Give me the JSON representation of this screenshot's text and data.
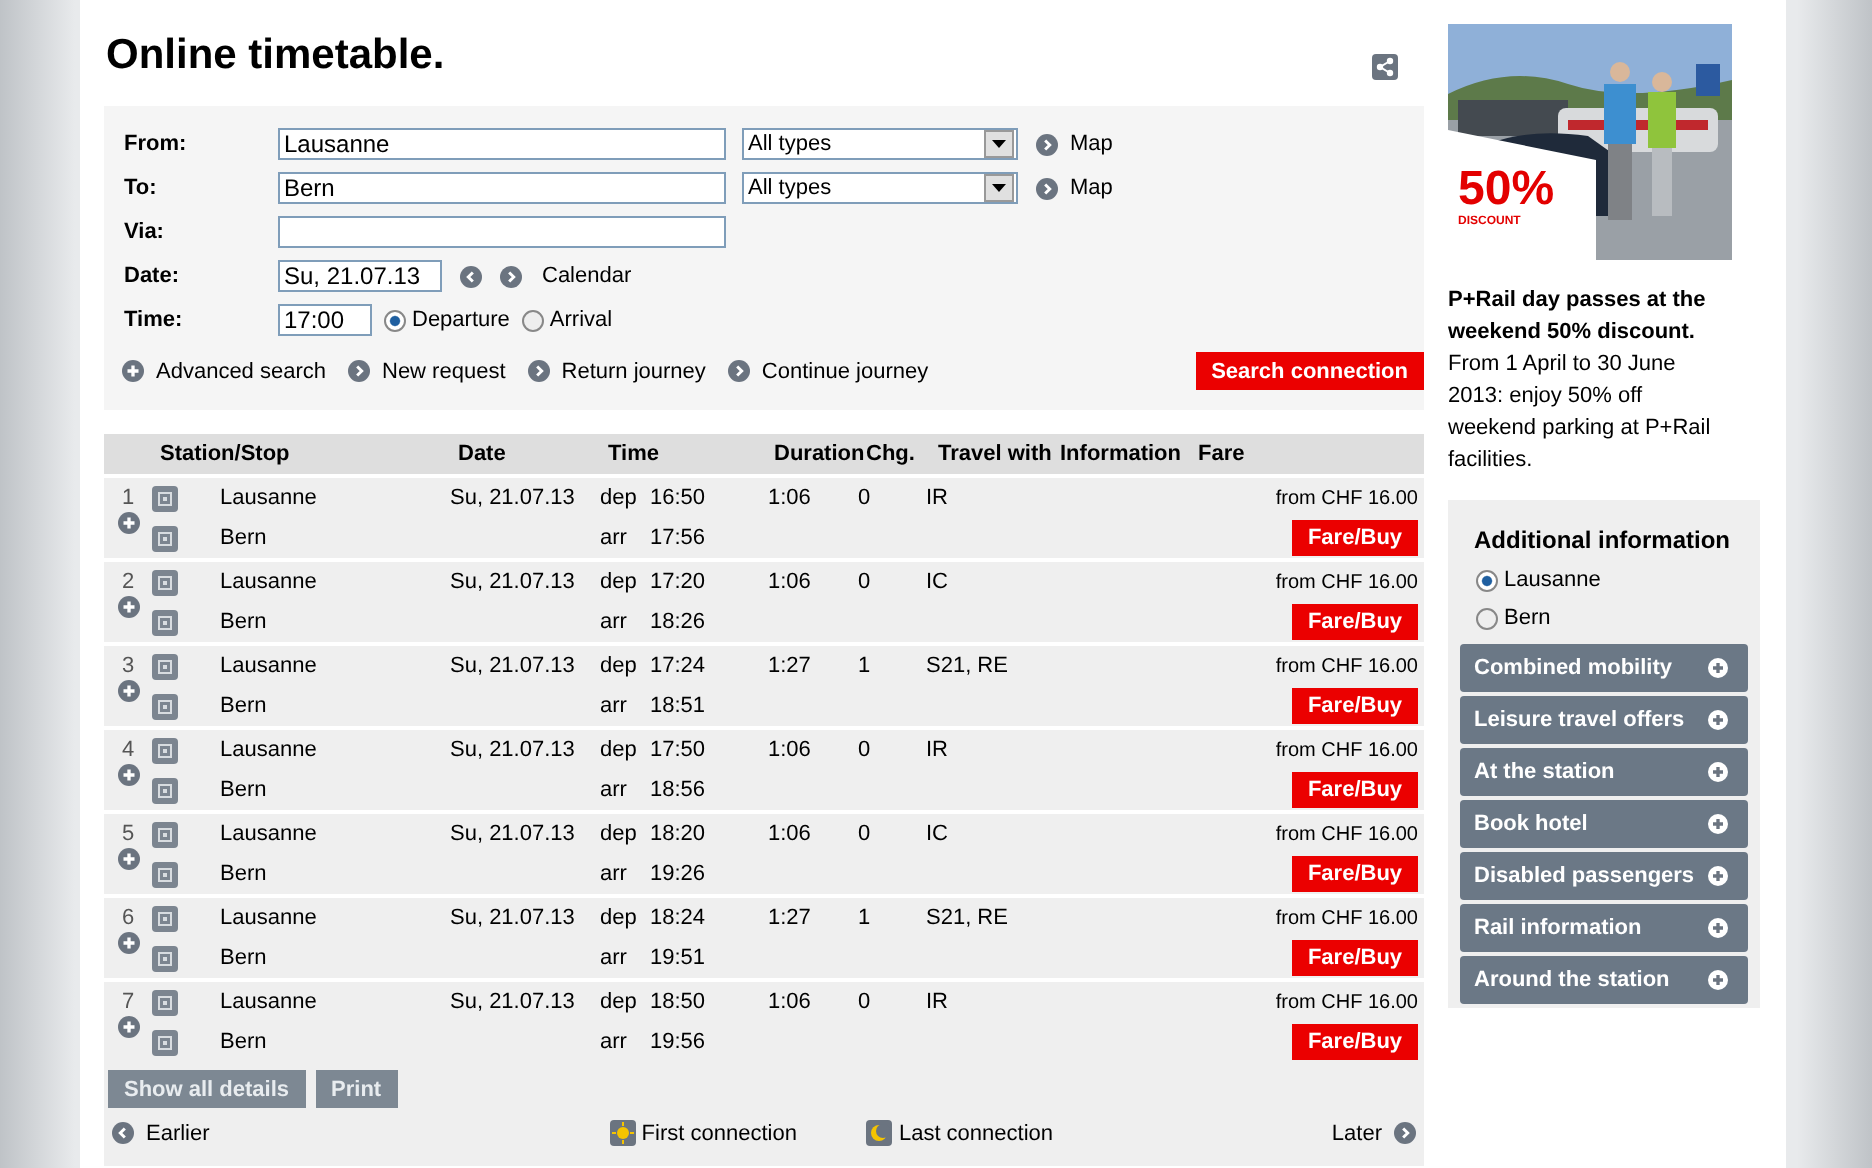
{
  "title": "Online timetable.",
  "form": {
    "rows": [
      {
        "kind": "station",
        "label": "From:",
        "value": "Lausanne",
        "type": "All types",
        "link": "Map"
      },
      {
        "kind": "station",
        "label": "To:",
        "value": "Bern",
        "type": "All types",
        "link": "Map"
      },
      {
        "kind": "via",
        "label": "Via:"
      },
      {
        "kind": "date",
        "label": "Date:",
        "value": "Su, 21.07.13",
        "link": "Calendar"
      },
      {
        "kind": "time",
        "label": "Time:",
        "value": "17:00",
        "options": [
          {
            "label": "Departure",
            "selected": true
          },
          {
            "label": "Arrival",
            "selected": false
          }
        ]
      }
    ],
    "links": [
      {
        "label": "Advanced search",
        "kind": "plus"
      },
      {
        "label": "New request",
        "kind": "arrow"
      },
      {
        "label": "Return journey",
        "kind": "arrow"
      },
      {
        "label": "Continue journey",
        "kind": "arrow"
      }
    ],
    "submit": "Search connection"
  },
  "table": {
    "columns": [
      "Station/Stop",
      "Date",
      "Time",
      "Duration",
      "Chg.",
      "Travel with",
      "Information",
      "Fare"
    ],
    "rows": [
      {
        "number": "1",
        "from": "Lausanne",
        "to": "Bern",
        "date": "Su, 21.07.13",
        "dep": "dep",
        "dep_time": "16:50",
        "arr": "arr",
        "arr_time": "17:56",
        "duration": "1:06",
        "changes": "0",
        "travel_with": "IR",
        "fare": "from CHF 16.00",
        "button": "Fare/Buy"
      },
      {
        "number": "2",
        "from": "Lausanne",
        "to": "Bern",
        "date": "Su, 21.07.13",
        "dep": "dep",
        "dep_time": "17:20",
        "arr": "arr",
        "arr_time": "18:26",
        "duration": "1:06",
        "changes": "0",
        "travel_with": "IC",
        "fare": "from CHF 16.00",
        "button": "Fare/Buy"
      },
      {
        "number": "3",
        "from": "Lausanne",
        "to": "Bern",
        "date": "Su, 21.07.13",
        "dep": "dep",
        "dep_time": "17:24",
        "arr": "arr",
        "arr_time": "18:51",
        "duration": "1:27",
        "changes": "1",
        "travel_with": "S21, RE",
        "fare": "from CHF 16.00",
        "button": "Fare/Buy"
      },
      {
        "number": "4",
        "from": "Lausanne",
        "to": "Bern",
        "date": "Su, 21.07.13",
        "dep": "dep",
        "dep_time": "17:50",
        "arr": "arr",
        "arr_time": "18:56",
        "duration": "1:06",
        "changes": "0",
        "travel_with": "IR",
        "fare": "from CHF 16.00",
        "button": "Fare/Buy"
      },
      {
        "number": "5",
        "from": "Lausanne",
        "to": "Bern",
        "date": "Su, 21.07.13",
        "dep": "dep",
        "dep_time": "18:20",
        "arr": "arr",
        "arr_time": "19:26",
        "duration": "1:06",
        "changes": "0",
        "travel_with": "IC",
        "fare": "from CHF 16.00",
        "button": "Fare/Buy"
      },
      {
        "number": "6",
        "from": "Lausanne",
        "to": "Bern",
        "date": "Su, 21.07.13",
        "dep": "dep",
        "dep_time": "18:24",
        "arr": "arr",
        "arr_time": "19:51",
        "duration": "1:27",
        "changes": "1",
        "travel_with": "S21, RE",
        "fare": "from CHF 16.00",
        "button": "Fare/Buy"
      },
      {
        "number": "7",
        "from": "Lausanne",
        "to": "Bern",
        "date": "Su, 21.07.13",
        "dep": "dep",
        "dep_time": "18:50",
        "arr": "arr",
        "arr_time": "19:56",
        "duration": "1:06",
        "changes": "0",
        "travel_with": "IR",
        "fare": "from CHF 16.00",
        "button": "Fare/Buy"
      }
    ],
    "buttons": [
      "Show all details",
      "Print"
    ],
    "nav": {
      "earlier": "Earlier",
      "first": "First connection",
      "last": "Last connection",
      "later": "Later"
    }
  },
  "ad": {
    "badge": "50%",
    "badge_caption": "DISCOUNT",
    "headline": "P+Rail day passes at the weekend 50% discount.",
    "text": "From 1 April to 30 June 2013: enjoy 50% off weekend parking at P+Rail facilities."
  },
  "info": {
    "title": "Additional information",
    "stations": [
      {
        "label": "Lausanne",
        "selected": true
      },
      {
        "label": "Bern",
        "selected": false
      }
    ],
    "items": [
      "Combined mobility",
      "Leisure travel offers",
      "At the station",
      "Book hotel",
      "Disabled passengers",
      "Rail information",
      "Around the station"
    ]
  }
}
